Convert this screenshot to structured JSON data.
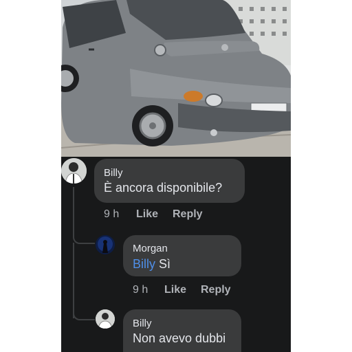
{
  "post": {
    "image": "car-photo"
  },
  "comments": [
    {
      "author": "Billy",
      "text": "È ancora disponibile?",
      "time": "9 h",
      "like": "Like",
      "reply": "Reply"
    },
    {
      "author": "Morgan",
      "mention": "Billy",
      "text": "Sì",
      "time": "9 h",
      "like": "Like",
      "reply": "Reply"
    },
    {
      "author": "Billy",
      "text": "Non avevo dubbi"
    }
  ],
  "colors": {
    "thread_bg": "#18191a",
    "bubble": "#3a3b3c",
    "text": "#e4e6eb",
    "muted": "#b0b3b8",
    "mention": "#4f8fe8"
  }
}
